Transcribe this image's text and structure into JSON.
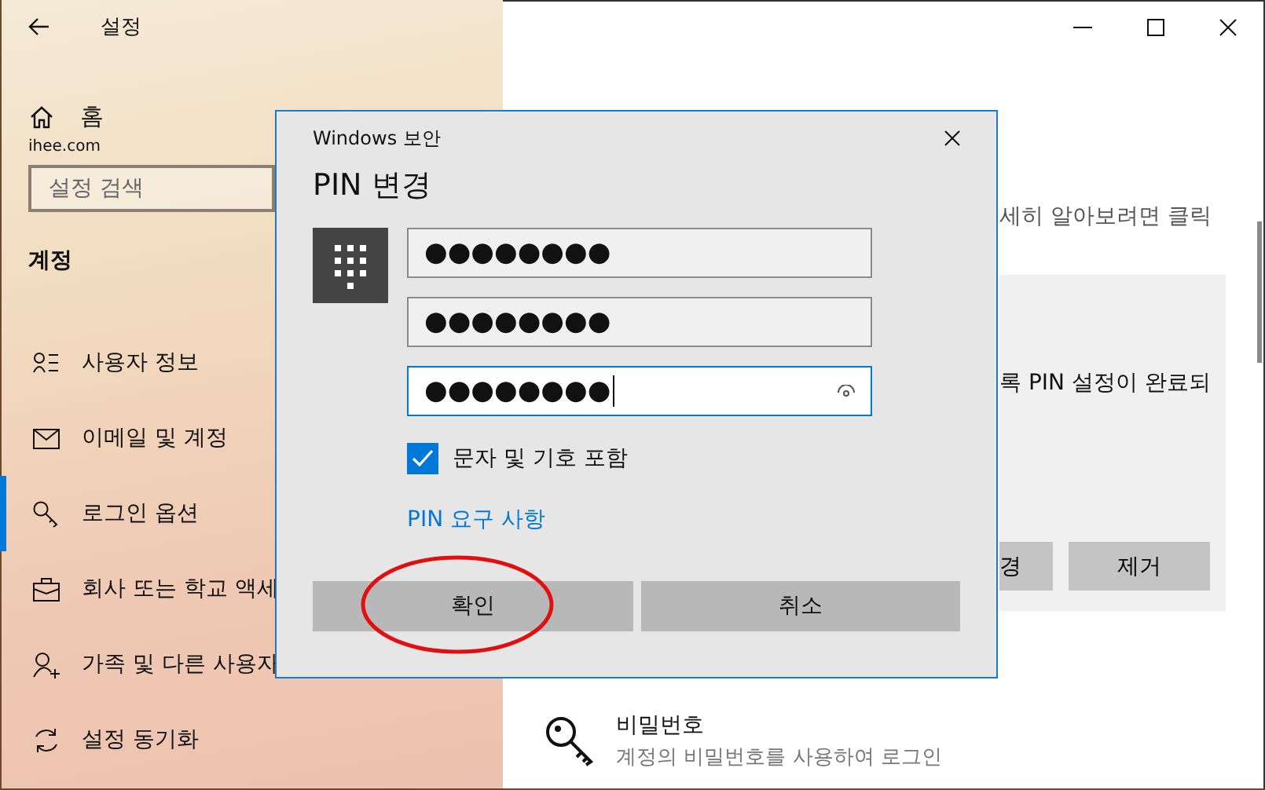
{
  "window": {
    "title": "설정"
  },
  "sidebar": {
    "home": "홈",
    "account": "ihee.com",
    "search": {
      "placeholder": "설정 검색"
    },
    "section": "계정",
    "items": [
      {
        "label": "사용자 정보",
        "selected": false
      },
      {
        "label": "이메일 및 계정",
        "selected": false
      },
      {
        "label": "로그인 옵션",
        "selected": true
      },
      {
        "label": "회사 또는 학교 액세",
        "selected": false
      },
      {
        "label": "가족 및 다른 사용자",
        "selected": false
      },
      {
        "label": "설정 동기화",
        "selected": false
      }
    ]
  },
  "main": {
    "help_text": "세히 알아보려면 클릭",
    "card": {
      "text": "록 PIN 설정이 완료되",
      "buttons": [
        "경",
        "제거"
      ]
    },
    "password": {
      "title": "비밀번호",
      "description": "계정의 비밀번호를 사용하여 로그인"
    }
  },
  "dialog": {
    "caption": "Windows 보안",
    "title": "PIN 변경",
    "fields": [
      {
        "value": "●●●●●●●●",
        "focused": false
      },
      {
        "value": "●●●●●●●●",
        "focused": false
      },
      {
        "value": "●●●●●●●●",
        "focused": true
      }
    ],
    "checkbox": {
      "label": "문자 및 기호 포함",
      "checked": true
    },
    "link": "PIN 요구 사항",
    "buttons": [
      {
        "label": "확인",
        "highlighted": true
      },
      {
        "label": "취소",
        "highlighted": false
      }
    ]
  }
}
